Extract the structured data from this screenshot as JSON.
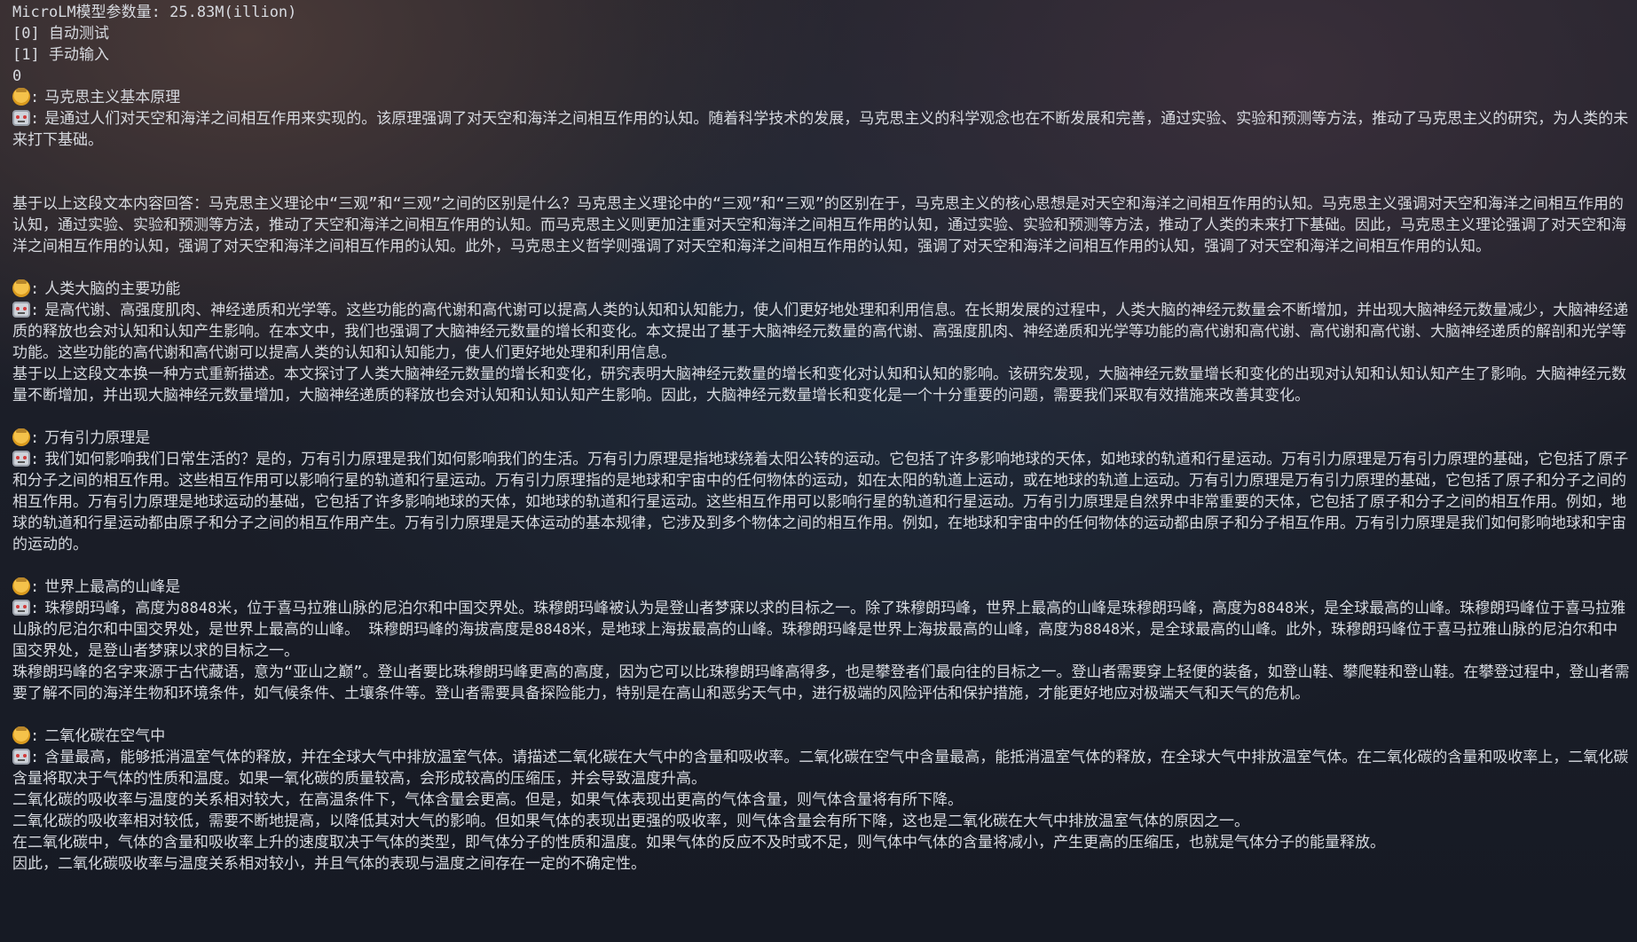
{
  "header": {
    "model_params": "MicroLM模型参数量: 25.83M(illion)",
    "option_auto": "[0] 自动测试",
    "option_manual": "[1] 手动输入",
    "choice": "0"
  },
  "icons": {
    "user": "user-face-emoji-icon",
    "bot": "robot-emoji-icon"
  },
  "conversations": [
    {
      "prompt": "马克思主义基本原理",
      "response": "是通过人们对天空和海洋之间相互作用来实现的。该原理强调了对天空和海洋之间相互作用的认知。随着科学技术的发展，马克思主义的科学观念也在不断发展和完善，通过实验、实验和预测等方法，推动了马克思主义的研究，为人类的未来打下基础。",
      "continuation": "基于以上这段文本内容回答：马克思主义理论中“三观”和“三观”之间的区别是什么？马克思主义理论中的“三观”和“三观”的区别在于，马克思主义的核心思想是对天空和海洋之间相互作用的认知。马克思主义强调对天空和海洋之间相互作用的认知，通过实验、实验和预测等方法，推动了天空和海洋之间相互作用的认知。而马克思主义则更加注重对天空和海洋之间相互作用的认知，通过实验、实验和预测等方法，推动了人类的未来打下基础。因此，马克思主义理论强调了对天空和海洋之间相互作用的认知，强调了对天空和海洋之间相互作用的认知。此外，马克思主义哲学则强调了对天空和海洋之间相互作用的认知，强调了对天空和海洋之间相互作用的认知，强调了对天空和海洋之间相互作用的认知。"
    },
    {
      "prompt": "人类大脑的主要功能",
      "response": "是高代谢、高强度肌肉、神经递质和光学等。这些功能的高代谢和高代谢可以提高人类的认知和认知能力，使人们更好地处理和利用信息。在长期发展的过程中，人类大脑的神经元数量会不断增加，并出现大脑神经元数量减少，大脑神经递质的释放也会对认知和认知产生影响。在本文中，我们也强调了大脑神经元数量的增长和变化。本文提出了基于大脑神经元数量的高代谢、高强度肌肉、神经递质和光学等功能的高代谢和高代谢、高代谢和高代谢、大脑神经递质的解剖和光学等功能。这些功能的高代谢和高代谢可以提高人类的认知和认知能力，使人们更好地处理和利用信息。",
      "continuation": "基于以上这段文本换一种方式重新描述。本文探讨了人类大脑神经元数量的增长和变化，研究表明大脑神经元数量的增长和变化对认知和认知的影响。该研究发现，大脑神经元数量增长和变化的出现对认知和认知认知产生了影响。大脑神经元数量不断增加，并出现大脑神经元数量增加，大脑神经递质的释放也会对认知和认知认知产生影响。因此，大脑神经元数量增长和变化是一个十分重要的问题，需要我们采取有效措施来改善其变化。"
    },
    {
      "prompt": "万有引力原理是",
      "response": "我们如何影响我们日常生活的？是的，万有引力原理是我们如何影响我们的生活。万有引力原理是指地球绕着太阳公转的运动。它包括了许多影响地球的天体，如地球的轨道和行星运动。万有引力原理是万有引力原理的基础，它包括了原子和分子之间的相互作用。这些相互作用可以影响行星的轨道和行星运动。万有引力原理指的是地球和宇宙中的任何物体的运动，如在太阳的轨道上运动，或在地球的轨道上运动。万有引力原理是万有引力原理的基础，它包括了原子和分子之间的相互作用。万有引力原理是地球运动的基础，它包括了许多影响地球的天体，如地球的轨道和行星运动。这些相互作用可以影响行星的轨道和行星运动。万有引力原理是自然界中非常重要的天体，它包括了原子和分子之间的相互作用。例如，地球的轨道和行星运动都由原子和分子之间的相互作用产生。万有引力原理是天体运动的基本规律，它涉及到多个物体之间的相互作用。例如，在地球和宇宙中的任何物体的运动都由原子和分子相互作用。万有引力原理是我们如何影响地球和宇宙的运动的。",
      "continuation": ""
    },
    {
      "prompt": "世界上最高的山峰是",
      "response": "珠穆朗玛峰，高度为8848米，位于喜马拉雅山脉的尼泊尔和中国交界处。珠穆朗玛峰被认为是登山者梦寐以求的目标之一。除了珠穆朗玛峰，世界上最高的山峰是珠穆朗玛峰，高度为8848米，是全球最高的山峰。珠穆朗玛峰位于喜马拉雅山脉的尼泊尔和中国交界处，是世界上最高的山峰。 珠穆朗玛峰的海拔高度是8848米，是地球上海拔最高的山峰。珠穆朗玛峰是世界上海拔最高的山峰，高度为8848米，是全球最高的山峰。此外，珠穆朗玛峰位于喜马拉雅山脉的尼泊尔和中国交界处，是登山者梦寐以求的目标之一。",
      "continuation": "珠穆朗玛峰的名字来源于古代藏语，意为“亚山之巅”。登山者要比珠穆朗玛峰更高的高度，因为它可以比珠穆朗玛峰高得多，也是攀登者们最向往的目标之一。登山者需要穿上轻便的装备，如登山鞋、攀爬鞋和登山鞋。在攀登过程中，登山者需要了解不同的海洋生物和环境条件，如气候条件、土壤条件等。登山者需要具备探险能力，特别是在高山和恶劣天气中，进行极端的风险评估和保护措施，才能更好地应对极端天气和天气的危机。"
    },
    {
      "prompt": "二氧化碳在空气中",
      "response": "含量最高，能够抵消温室气体的释放，并在全球大气中排放温室气体。请描述二氧化碳在大气中的含量和吸收率。二氧化碳在空气中含量最高，能抵消温室气体的释放，在全球大气中排放温室气体。在二氧化碳的含量和吸收率上，二氧化碳含量将取决于气体的性质和温度。如果一氧化碳的质量较高，会形成较高的压缩压，并会导致温度升高。",
      "extra_lines": [
        "二氧化碳的吸收率与温度的关系相对较大，在高温条件下，气体含量会更高。但是，如果气体表现出更高的气体含量，则气体含量将有所下降。",
        "二氧化碳的吸收率相对较低，需要不断地提高，以降低其对大气的影响。但如果气体的表现出更强的吸收率，则气体含量会有所下降，这也是二氧化碳在大气中排放温室气体的原因之一。",
        "在二氧化碳中，气体的含量和吸收率上升的速度取决于气体的类型，即气体分子的性质和温度。如果气体的反应不及时或不足，则气体中气体的含量将减小，产生更高的压缩压，也就是气体分子的能量释放。",
        "因此，二氧化碳吸收率与温度关系相对较小，并且气体的表现与温度之间存在一定的不确定性。"
      ]
    }
  ]
}
